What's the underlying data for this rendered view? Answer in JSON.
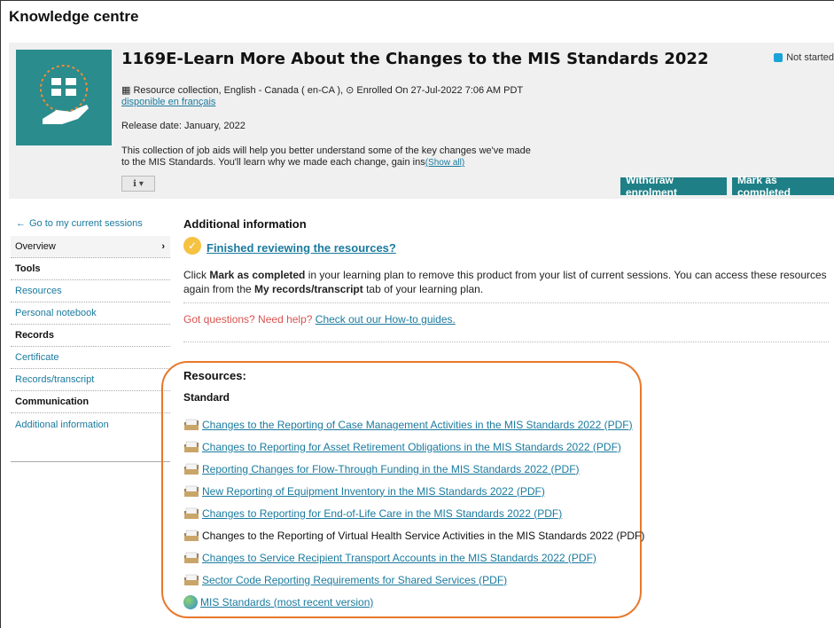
{
  "page": {
    "title": "Knowledge centre"
  },
  "course": {
    "title": "1169E-Learn More About the Changes to the MIS Standards 2022",
    "status": "Not started",
    "meta_line": "Resource collection, English - Canada ( en-CA ), ⊙ Enrolled On 27-Jul-2022 7:06 AM PDT",
    "french_link": "disponible en français",
    "release_label": "Release date:",
    "release_value": "January, 2022",
    "description_line1": "This collection of job aids will help you better understand some of the key changes we've made",
    "description_line2": "to the MIS Standards. You'll learn why we made each change, gain ins",
    "show_all": "(Show all)",
    "withdraw_label": "Withdraw enrolment",
    "complete_label": "Mark as completed"
  },
  "sidebar": {
    "go_current": "Go to my current sessions",
    "overview": "Overview",
    "tools_header": "Tools",
    "resources": "Resources",
    "personal_notebook": "Personal notebook",
    "records_header": "Records",
    "certificate": "Certificate",
    "records_transcript": "Records/transcript",
    "communication_header": "Communication",
    "additional_information": "Additional information"
  },
  "main": {
    "additional_title": "Additional information",
    "finished_link": "Finished reviewing the resources?",
    "explain_pre": "Click ",
    "explain_bold1": "Mark as completed",
    "explain_mid": " in your learning plan to remove this product from your list of current sessions. You can access these resources again from the ",
    "explain_bold2": "My records/transcript",
    "explain_post": " tab of your learning plan.",
    "help_text": "Got questions? Need help?",
    "help_link": "Check out our How-to guides.",
    "resources_title": "Resources:",
    "standard_label": "Standard",
    "resources": [
      {
        "label": "Changes to the Reporting of Case Management Activities in the MIS Standards 2022 (PDF)",
        "icon": "document-icon",
        "linked": true
      },
      {
        "label": "Changes to Reporting for Asset Retirement Obligations in the MIS Standards 2022 (PDF)",
        "icon": "document-icon",
        "linked": true
      },
      {
        "label": "Reporting Changes for Flow-Through Funding in the MIS Standards 2022 (PDF)",
        "icon": "document-icon",
        "linked": true
      },
      {
        "label": "New Reporting of Equipment Inventory in the MIS Standards 2022 (PDF)",
        "icon": "document-icon",
        "linked": true
      },
      {
        "label": "Changes to Reporting for End-of-Life Care in the MIS Standards 2022 (PDF)",
        "icon": "document-icon",
        "linked": true
      },
      {
        "label": "Changes to the Reporting of Virtual Health Service Activities in the MIS Standards 2022 (PDF)",
        "icon": "document-icon",
        "linked": false
      },
      {
        "label": "Changes to Service Recipient Transport Accounts in the MIS Standards 2022 (PDF)",
        "icon": "document-icon",
        "linked": true
      },
      {
        "label": "Sector Code Reporting Requirements for Shared Services (PDF)",
        "icon": "document-icon",
        "linked": true
      },
      {
        "label": "MIS Standards (most recent version)",
        "icon": "globe-icon",
        "linked": true
      }
    ]
  },
  "colors": {
    "accent": "#1e7f86",
    "link": "#1a7a9e",
    "status": "#1aa3d8",
    "highlight": "#e8782a",
    "thumb": "#2a8c8c"
  }
}
